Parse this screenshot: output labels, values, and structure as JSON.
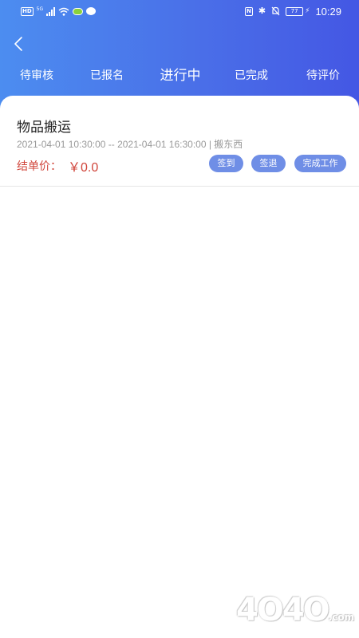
{
  "status_bar": {
    "network_badge": "HD",
    "network_type": "5G",
    "battery": "77",
    "time": "10:29",
    "icons": [
      "signal-icon",
      "wifi-icon",
      "green-app-icon",
      "chat-icon",
      "nfc-icon",
      "bluetooth-icon",
      "mute-icon",
      "battery-icon",
      "charging-icon"
    ]
  },
  "header": {
    "back_icon": "chevron-left-icon",
    "tabs": [
      {
        "label": "待审核",
        "active": false
      },
      {
        "label": "已报名",
        "active": false
      },
      {
        "label": "进行中",
        "active": true
      },
      {
        "label": "已完成",
        "active": false
      },
      {
        "label": "待评价",
        "active": false
      }
    ],
    "gradient_start": "#4c8df0",
    "gradient_end": "#4457e4"
  },
  "orders": [
    {
      "title": "物品搬运",
      "start_time": "2021-04-01 10:30:00",
      "end_time": "2021-04-01 16:30:00",
      "category": "搬东西",
      "meta_line": "2021-04-01 10:30:00 -- 2021-04-01 16:30:00 | 搬东西",
      "price_label": "结单价：",
      "price_value": "￥0.0",
      "actions": {
        "checkin": "签到",
        "checkout": "签退",
        "complete": "完成工作"
      }
    }
  ],
  "colors": {
    "price": "#d0443a",
    "action_button": "#6f8ee6",
    "meta_text": "#9a9a9a"
  },
  "watermark": {
    "text": "4O4O",
    "suffix": ".com"
  }
}
